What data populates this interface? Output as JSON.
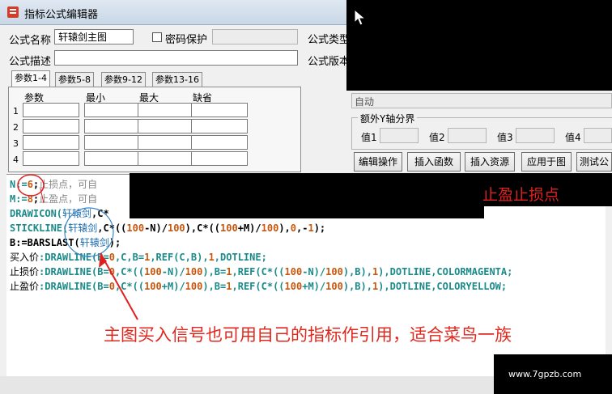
{
  "window": {
    "title": "指标公式编辑器"
  },
  "form": {
    "name_label": "公式名称",
    "name_value": "轩辕剑主图",
    "password_label": "密码保护",
    "type_label": "公式类型",
    "desc_label": "公式描述",
    "version_label": "公式版本"
  },
  "tabs": [
    "参数1-4",
    "参数5-8",
    "参数9-12",
    "参数13-16"
  ],
  "params": {
    "headers": [
      "参数",
      "最小",
      "最大",
      "缺省"
    ],
    "rows": [
      "1",
      "2",
      "3",
      "4"
    ]
  },
  "right_panel": {
    "auto_value": "自动",
    "axis_group_title": "额外Y轴分界",
    "value_labels": [
      "值1",
      "值2",
      "值3",
      "值4"
    ],
    "buttons": [
      "编辑操作",
      "插入函数",
      "插入资源",
      "应用于图",
      "测试公"
    ]
  },
  "code": {
    "line1": {
      "a": "N:=",
      "b": "6",
      "c": ";",
      "note": "止损点，可自"
    },
    "line2": {
      "a": "M:=",
      "b": "8",
      "c": ";",
      "note": "止盈点，可自"
    },
    "line3": {
      "a": "DRAWICON(",
      "ref": "轩辕剑",
      "b": ",C*"
    },
    "line4": {
      "a": "STICKLINE(",
      "ref": "轩辕剑",
      "b": ",C*((",
      "n1": "100",
      "c": "-N)/",
      "n2": "100",
      "d": "),C*((",
      "n3": "100",
      "e": "+M)/",
      "n4": "100",
      "f": "),",
      "n5": "0",
      "g": ",-",
      "n6": "1",
      "h": ");"
    },
    "line5": {
      "a": "B:=BARSLAST(",
      "ref": "轩辕剑",
      "b": ");"
    },
    "line6": {
      "label": "买入价",
      "a": ":DRAWLINE(B=",
      "n1": "0",
      "b": ",C,B=",
      "n2": "1",
      "c": ",REF(C,B),",
      "n3": "1",
      "d": ",DOTLINE;"
    },
    "line7": {
      "label": "止损价",
      "a": ":DRAWLINE(B=",
      "n1": "0",
      "b": ",C*((",
      "n2": "100",
      "c": "-N)/",
      "n3": "100",
      "d": "),B=",
      "n4": "1",
      "e": ",REF(C*((",
      "n5": "100",
      "f": "-N)/",
      "n6": "100",
      "g": "),B),",
      "n7": "1",
      "h": "),DOTLINE,COLORMAGENTA;"
    },
    "line8": {
      "label": "止盈价",
      "a": ":DRAWLINE(B=",
      "n1": "0",
      "b": ",C*((",
      "n2": "100",
      "c": "+M)/",
      "n3": "100",
      "d": "),B=",
      "n4": "1",
      "e": ",REF(C*((",
      "n5": "100",
      "f": "+M)/",
      "n6": "100",
      "g": "),B),",
      "n7": "1",
      "h": "),DOTLINE,COLORYELLOW;"
    }
  },
  "annotations": {
    "stop_note": "止盈止损点",
    "main_note": "主图买入信号也可用自己的指标作引用，适合菜鸟一族"
  },
  "watermark": "www.7gpzb.com"
}
